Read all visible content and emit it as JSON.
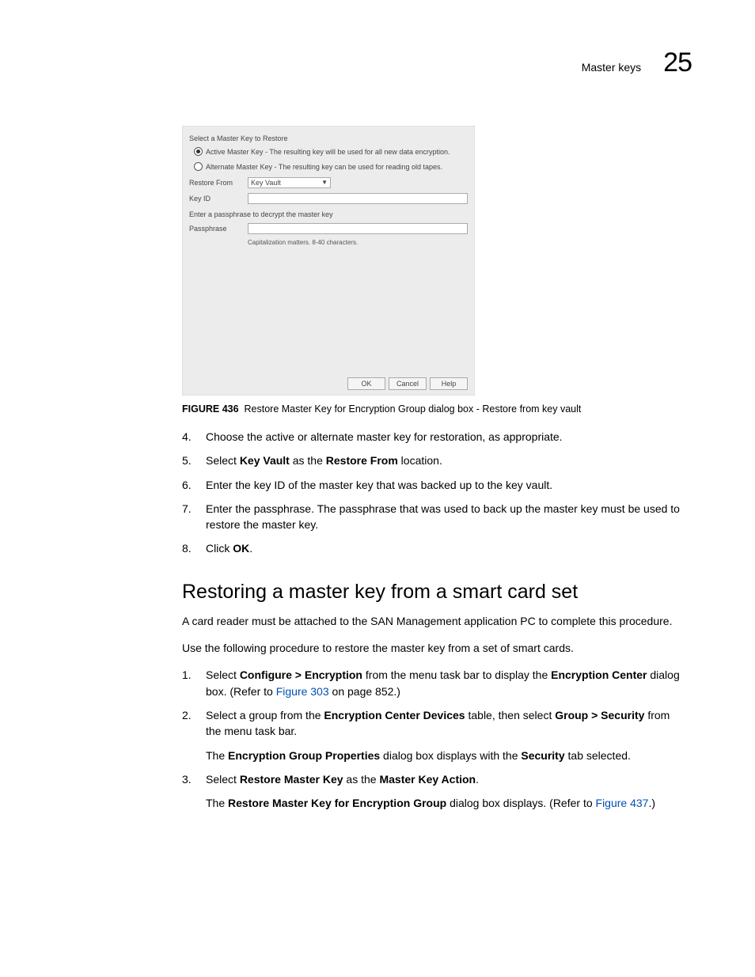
{
  "header": {
    "label": "Master keys",
    "chapter": "25"
  },
  "dialog": {
    "title": "Select a Master Key to Restore",
    "opt_active": "Active Master Key - The resulting key will be used for all new data encryption.",
    "opt_alternate": "Alternate Master Key - The resulting key can be used for reading old tapes.",
    "restore_from_label": "Restore From",
    "restore_from_value": "Key Vault",
    "key_id_label": "Key ID",
    "passphrase_prompt": "Enter a passphrase to decrypt the master key",
    "passphrase_label": "Passphrase",
    "passphrase_hint": "Capitalization matters. 8-40 characters.",
    "btn_ok": "OK",
    "btn_cancel": "Cancel",
    "btn_help": "Help"
  },
  "caption": {
    "fig_label": "FIGURE 436",
    "fig_text": "Restore Master Key for Encryption Group dialog box - Restore from key vault"
  },
  "steps_a": {
    "s4": "Choose the active or alternate master key for restoration, as appropriate.",
    "s5_pre": "Select ",
    "s5_b1": "Key Vault",
    "s5_mid": " as the ",
    "s5_b2": "Restore From",
    "s5_post": " location.",
    "s6": "Enter the key ID of the master key that was backed up to the key vault.",
    "s7": "Enter the passphrase. The passphrase that was used to back up the master key must be used to restore the master key.",
    "s8_pre": "Click ",
    "s8_b": "OK",
    "s8_post": "."
  },
  "section": {
    "heading": "Restoring a master key from a smart card set",
    "p1": "A card reader must be attached to the SAN Management application PC to complete this procedure.",
    "p2": "Use the following procedure to restore the master key from a set of smart cards."
  },
  "steps_b": {
    "s1_pre": "Select ",
    "s1_b1": "Configure > Encryption",
    "s1_mid": " from the menu task bar to display the ",
    "s1_b2": "Encryption Center",
    "s1_post": " dialog box. (Refer to ",
    "s1_link": "Figure 303",
    "s1_end": " on page 852.)",
    "s2_pre": "Select a group from the ",
    "s2_b1": "Encryption Center Devices",
    "s2_mid": " table, then select ",
    "s2_b2": "Group > Security",
    "s2_post": " from the menu task bar.",
    "s2_sub_pre": "The ",
    "s2_sub_b1": "Encryption Group Properties",
    "s2_sub_mid": " dialog box displays with the ",
    "s2_sub_b2": "Security",
    "s2_sub_post": " tab selected.",
    "s3_pre": "Select ",
    "s3_b1": "Restore Master Key",
    "s3_mid": " as the ",
    "s3_b2": "Master Key Action",
    "s3_post": ".",
    "s3_sub_pre": "The ",
    "s3_sub_b1": "Restore Master Key for Encryption Group",
    "s3_sub_mid": " dialog box displays. (Refer to ",
    "s3_sub_link": "Figure 437",
    "s3_sub_post": ".)"
  }
}
